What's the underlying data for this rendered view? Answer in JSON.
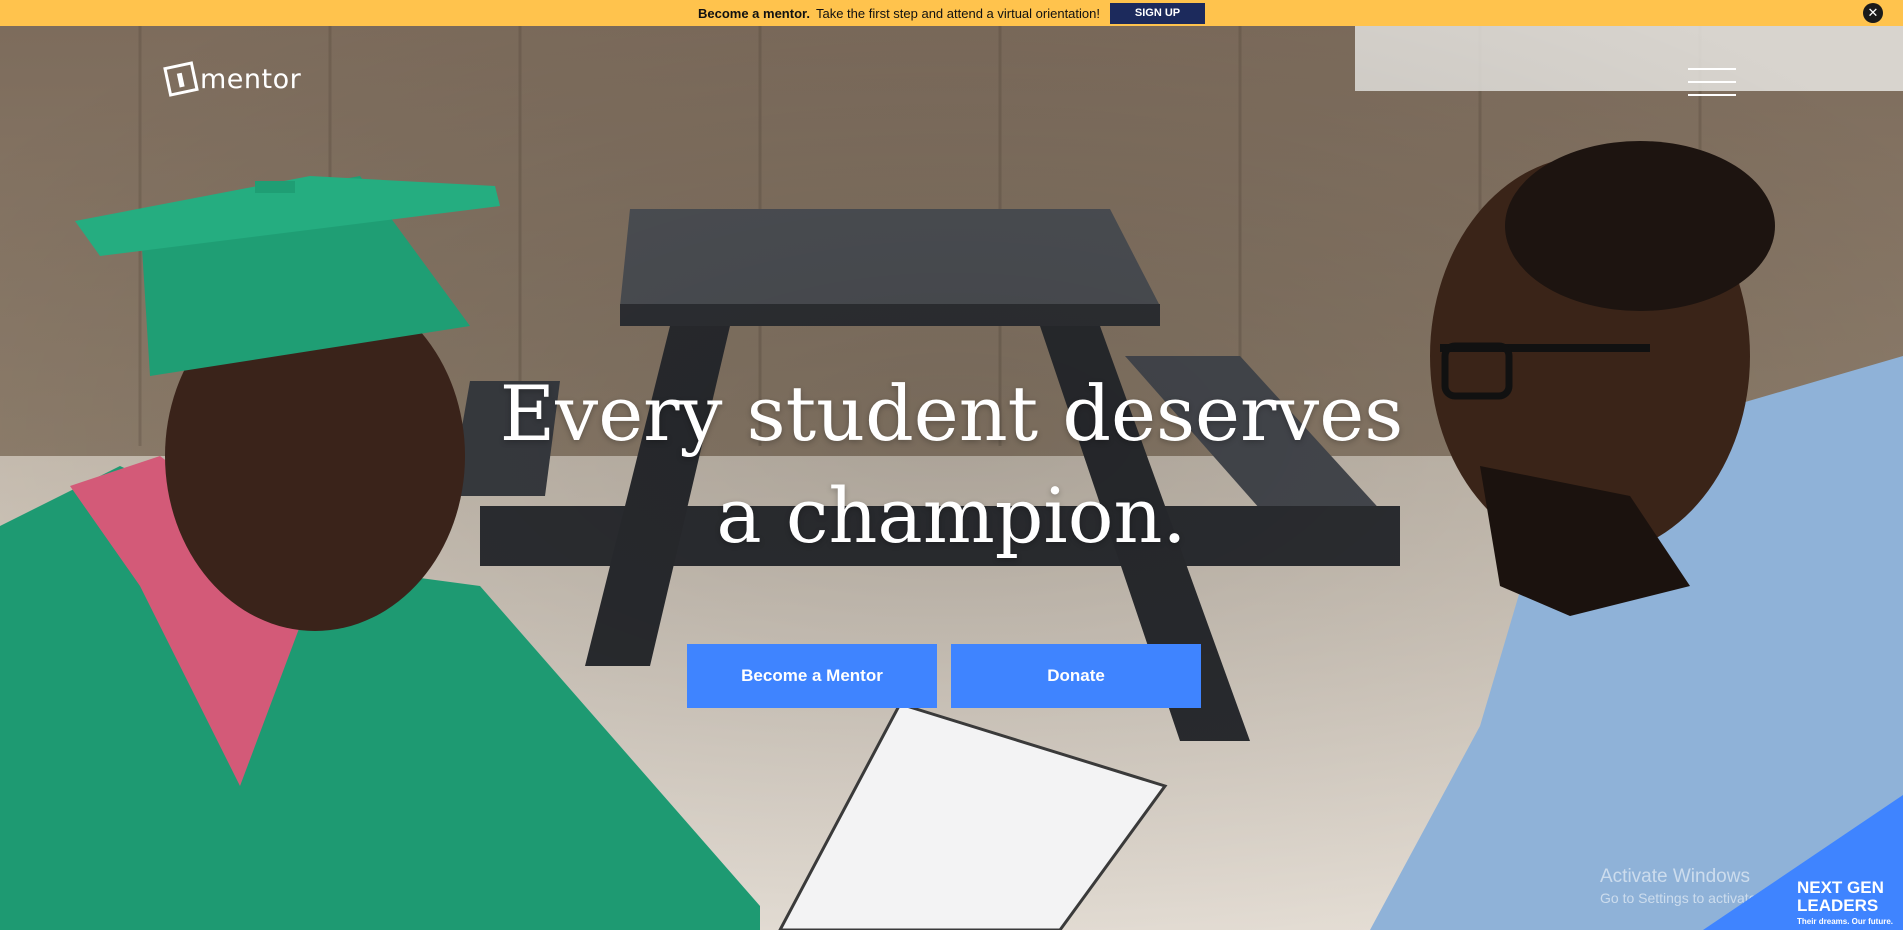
{
  "announcement": {
    "strong_text": "Become a mentor.",
    "text": "Take the first step and attend a virtual orientation!",
    "button_label": "SIGN UP",
    "close_label": "✕"
  },
  "header": {
    "logo_text": "mentor"
  },
  "hero": {
    "headline_line1": "Every student deserves",
    "headline_line2": "a champion.",
    "primary_button": "Become a Mentor",
    "secondary_button": "Donate"
  },
  "windows_watermark": {
    "line1": "Activate Windows",
    "line2": "Go to Settings to activate Windows."
  },
  "badge": {
    "line1": "NEXT GEN",
    "line2": "LEADERS",
    "line3": "Their dreams. Our future."
  },
  "colors": {
    "topbar": "#ffc34d",
    "signup": "#1c2a5c",
    "cta": "#3f84ff"
  },
  "icons": [
    "close-icon",
    "hamburger-menu-icon",
    "mentor-logo-icon"
  ]
}
